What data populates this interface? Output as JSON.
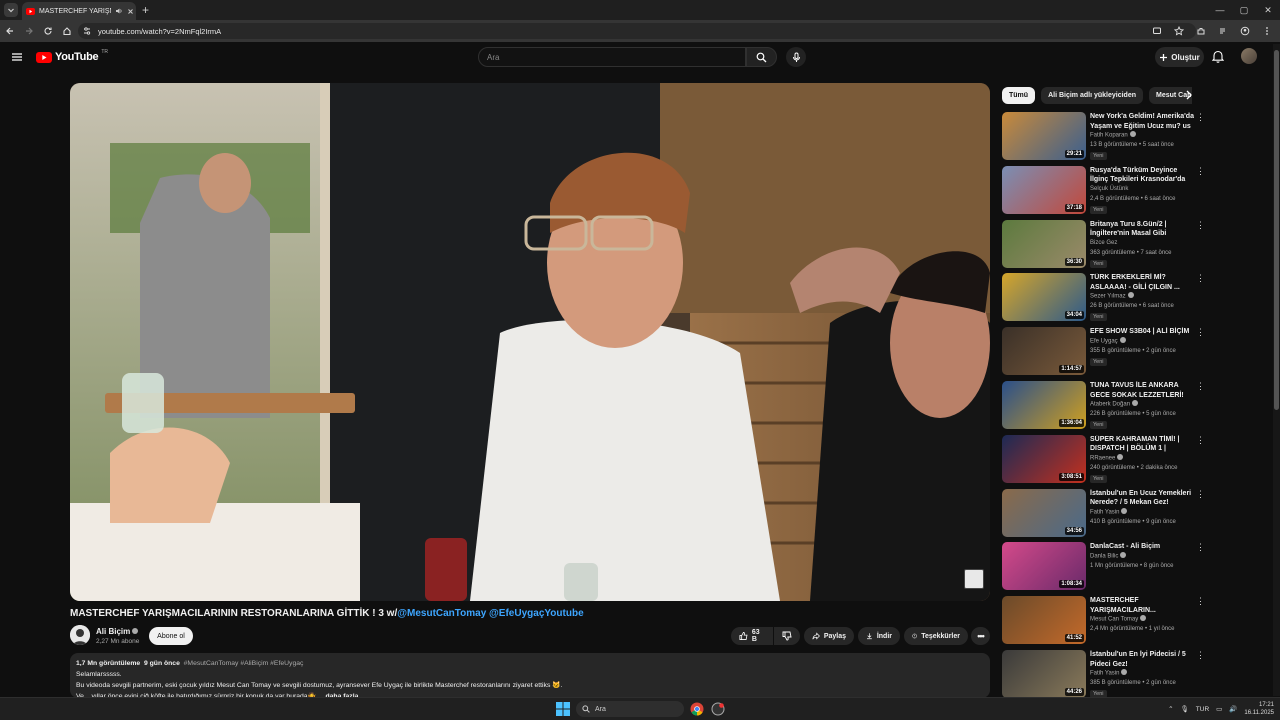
{
  "browser": {
    "tab_title": "MASTERCHEF YARIŞMACILARI...",
    "url": "youtube.com/watch?v=2NmFql2IrmA"
  },
  "masthead": {
    "logo_text": "YouTube",
    "country_code": "TR",
    "search_placeholder": "Ara",
    "create_label": "Oluştur"
  },
  "video": {
    "title_main": "MASTERCHEF YARIŞMACILARININ RESTORANLARINA GİTTİK ! 3 w/",
    "title_mentions": "@MesutCanTomay @EfeUygaçYoutube",
    "channel_name": "Ali Biçim",
    "subscribers": "2,27 Mn abone",
    "subscribe_label": "Abone ol",
    "like_count": "63 B",
    "share_label": "Paylaş",
    "download_label": "İndir",
    "thanks_label": "Teşekkürler"
  },
  "description": {
    "views": "1,7 Mn görüntüleme",
    "age": "9 gün önce",
    "hashtags": "#MesutCanTomay #AliBiçim #EfeUygaç",
    "line1": "Selamlarsssss.",
    "line2": "Bu videoda sevgili partnerim, eski çocuk yıldız Mesut Can Tomay ve sevgili dostumuz, ayransever Efe Uygaç ile birlikte Masterchef restoranlarını ziyaret ettiks 🐱.",
    "line3": "Ve... yıllar önce evini ciğ köfte ile batırdığımız sürpriz bir konuk da var burada🤷",
    "more_label": "...daha fazla"
  },
  "chips": [
    "Tümü",
    "Ali Biçim adlı yükleyiciden",
    "Mesut Can"
  ],
  "recommendations": [
    {
      "title": "New York'a Geldim! Amerika'da Yaşam ve Eğitim Ucuz mu? us",
      "channel": "Fatih Koparan",
      "verified": true,
      "meta": "13 B görüntüleme • 5 saat önce",
      "duration": "29:21",
      "badge": "Yeni",
      "thumb_colors": [
        "#c98a3a",
        "#3a5f8f"
      ]
    },
    {
      "title": "Rusya'da Türküm Deyince İlginç Tepkileri Krasnodar'da Fiyatlar...",
      "channel": "Selçuk Üstünk",
      "verified": false,
      "meta": "2,4 B görüntüleme • 6 saat önce",
      "duration": "37:18",
      "badge": "Yeni",
      "thumb_colors": [
        "#7a8fb5",
        "#c2483b"
      ]
    },
    {
      "title": "Britanya Turu 8.Gün/2 | İngiltere'nin Masal Gibi Köyleri...",
      "channel": "Bizce Gez",
      "verified": false,
      "meta": "363 görüntüleme • 7 saat önce",
      "duration": "36:30",
      "badge": "Yeni",
      "thumb_colors": [
        "#5c7a3e",
        "#9b8a6a"
      ]
    },
    {
      "title": "TÜRK ERKEKLERİ Mİ? ASLAAAA! - GİLİ ÇILGIN ...",
      "channel": "Sezer Yılmaz",
      "verified": true,
      "meta": "26 B görüntüleme • 6 saat önce",
      "duration": "34:04",
      "badge": "Yeni",
      "thumb_colors": [
        "#d6a62a",
        "#2d5a8a"
      ]
    },
    {
      "title": "EFE SHOW S3B04 | ALİ BİÇİM",
      "channel": "Efe Uygaç",
      "verified": true,
      "meta": "355 B görüntüleme • 2 gün önce",
      "duration": "1:14:57",
      "badge": "Yeni",
      "thumb_colors": [
        "#3a3028",
        "#7a5a3a"
      ]
    },
    {
      "title": "TUNA TAVUS İLE ANKARA GECE SOKAK LEZZETLERİ!",
      "channel": "Ataberk Doğan",
      "verified": true,
      "meta": "226 B görüntüleme • 5 gün önce",
      "duration": "1:36:04",
      "badge": "Yeni",
      "thumb_colors": [
        "#2a4f8a",
        "#d0a020"
      ]
    },
    {
      "title": "SÜPER KAHRAMAN TİMİ! | DISPATCH | BÖLÜM 1 |",
      "channel": "RRaenee",
      "verified": true,
      "meta": "240 görüntüleme • 2 dakika önce",
      "duration": "3:08:51",
      "badge": "Yeni",
      "thumb_colors": [
        "#1c2a55",
        "#c4301e"
      ]
    },
    {
      "title": "İstanbul'un En Ucuz Yemekleri Nerede? / 5 Mekan Gez!",
      "channel": "Fatih Yasin",
      "verified": true,
      "meta": "410 B görüntüleme • 9 gün önce",
      "duration": "34:56",
      "badge": "",
      "thumb_colors": [
        "#8a6a4a",
        "#4a6a8a"
      ]
    },
    {
      "title": "DanlaCast - Ali Biçim",
      "channel": "Danla Bilic",
      "verified": true,
      "meta": "1 Mn görüntüleme • 8 gün önce",
      "duration": "1:08:34",
      "badge": "",
      "thumb_colors": [
        "#d44a8a",
        "#6a2a6a"
      ]
    },
    {
      "title": "MASTERCHEF YARIŞMACILARIN...",
      "channel": "Mesut Can Tomay",
      "verified": true,
      "meta": "2,4 Mn görüntüleme • 1 yıl önce",
      "duration": "41:52",
      "badge": "",
      "thumb_colors": [
        "#6a4a2a",
        "#c46a2a"
      ]
    },
    {
      "title": "İstanbul'un En İyi Pidecisi / 5 Pideci Gez!",
      "channel": "Fatih Yasin",
      "verified": true,
      "meta": "385 B görüntüleme • 2 gün önce",
      "duration": "44:26",
      "badge": "Yeni",
      "thumb_colors": [
        "#3a3a3a",
        "#8a7a5a"
      ]
    }
  ],
  "taskbar": {
    "search_placeholder": "Ara",
    "lang": "TUR",
    "time": "17:21",
    "date": "16.11.2025"
  }
}
